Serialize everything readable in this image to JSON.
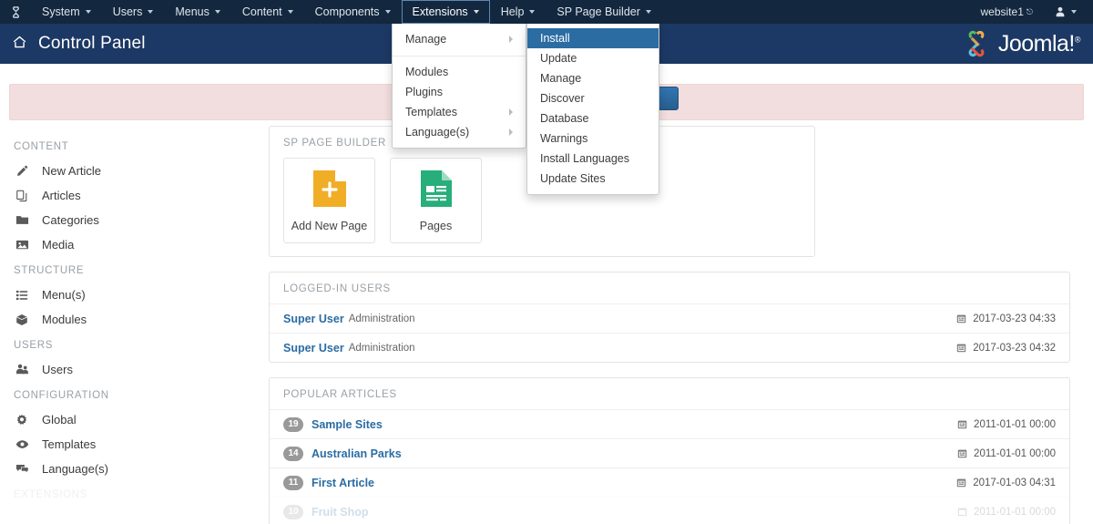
{
  "topbar": {
    "logo_icon": "joomla-mark-icon",
    "menus": [
      {
        "label": "System",
        "active": false
      },
      {
        "label": "Users",
        "active": false
      },
      {
        "label": "Menus",
        "active": false
      },
      {
        "label": "Content",
        "active": false
      },
      {
        "label": "Components",
        "active": false
      },
      {
        "label": "Extensions",
        "active": true
      },
      {
        "label": "Help",
        "active": false
      },
      {
        "label": "SP Page Builder",
        "active": false
      }
    ],
    "site_name": "website1",
    "site_external_icon": "external-link-icon",
    "user_icon": "user-icon"
  },
  "subheader": {
    "home_icon": "home-icon",
    "title": "Control Panel",
    "brand": "Joomla!",
    "brand_sup": "®"
  },
  "dropdowns": {
    "extensions": {
      "items": [
        {
          "label": "Manage",
          "submenu": true,
          "selected": false
        },
        {
          "separator": true
        },
        {
          "label": "Modules",
          "submenu": false,
          "selected": false
        },
        {
          "label": "Plugins",
          "submenu": false,
          "selected": false
        },
        {
          "label": "Templates",
          "submenu": true,
          "selected": false
        },
        {
          "label": "Language(s)",
          "submenu": true,
          "selected": false
        }
      ]
    },
    "manage_submenu": {
      "items": [
        {
          "label": "Install",
          "selected": true
        },
        {
          "label": "Update",
          "selected": false
        },
        {
          "label": "Manage",
          "selected": false
        },
        {
          "label": "Discover",
          "selected": false
        },
        {
          "label": "Database",
          "selected": false
        },
        {
          "label": "Warnings",
          "selected": false
        },
        {
          "label": "Install Languages",
          "selected": false
        },
        {
          "label": "Update Sites",
          "selected": false
        }
      ]
    }
  },
  "sidebar": {
    "groups": [
      {
        "title": "CONTENT",
        "items": [
          {
            "label": "New Article",
            "icon": "pencil-icon"
          },
          {
            "label": "Articles",
            "icon": "copy-icon"
          },
          {
            "label": "Categories",
            "icon": "folder-icon"
          },
          {
            "label": "Media",
            "icon": "image-icon"
          }
        ]
      },
      {
        "title": "STRUCTURE",
        "items": [
          {
            "label": "Menu(s)",
            "icon": "list-icon"
          },
          {
            "label": "Modules",
            "icon": "cube-icon"
          }
        ]
      },
      {
        "title": "USERS",
        "items": [
          {
            "label": "Users",
            "icon": "users-icon"
          }
        ]
      },
      {
        "title": "CONFIGURATION",
        "items": [
          {
            "label": "Global",
            "icon": "gear-icon"
          },
          {
            "label": "Templates",
            "icon": "eye-icon"
          },
          {
            "label": "Language(s)",
            "icon": "comments-icon"
          }
        ]
      },
      {
        "title": "EXTENSIONS",
        "items": []
      }
    ]
  },
  "panels": {
    "page_builder": {
      "title": "SP PAGE BUILDER",
      "tiles": [
        {
          "label": "Add New Page",
          "icon": "new-page-icon",
          "color": "#f0ad26"
        },
        {
          "label": "Pages",
          "icon": "pages-icon",
          "color": "#27ae7b"
        }
      ]
    },
    "logged_in_users": {
      "title": "LOGGED-IN USERS",
      "date_icon": "calendar-icon",
      "rows": [
        {
          "user": "Super User",
          "role": "Administration",
          "date": "2017-03-23 04:33"
        },
        {
          "user": "Super User",
          "role": "Administration",
          "date": "2017-03-23 04:32"
        }
      ]
    },
    "popular_articles": {
      "title": "POPULAR ARTICLES",
      "date_icon": "calendar-icon",
      "rows": [
        {
          "count": "19",
          "title": "Sample Sites",
          "date": "2011-01-01 00:00"
        },
        {
          "count": "14",
          "title": "Australian Parks",
          "date": "2011-01-01 00:00"
        },
        {
          "count": "11",
          "title": "First Article",
          "date": "2017-01-03 04:31"
        },
        {
          "count": "10",
          "title": "Fruit Shop",
          "date": "2011-01-01 00:00"
        }
      ]
    }
  },
  "alert": {
    "button_icon": "action-button-icon"
  },
  "colors": {
    "topbar": "#13283f",
    "subheader": "#1c3864",
    "accent": "#2b6ca3",
    "alert_bg": "#f2dede"
  }
}
